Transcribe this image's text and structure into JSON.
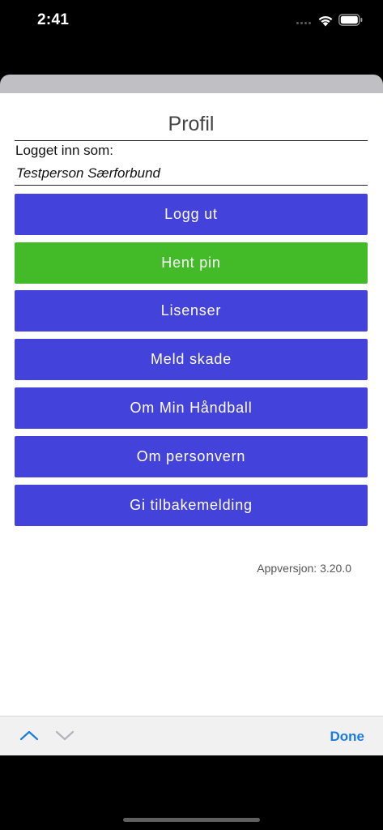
{
  "status_bar": {
    "time": "2:41"
  },
  "profile": {
    "title": "Profil",
    "logged_in_label": "Logget inn som:",
    "user_name": "Testperson Særforbund"
  },
  "buttons": {
    "logout": "Logg ut",
    "get_pin": "Hent pin",
    "licenses": "Lisenser",
    "report_injury": "Meld skade",
    "about_app": "Om Min Håndball",
    "privacy": "Om personvern",
    "feedback": "Gi tilbakemelding"
  },
  "version": "Appversjon: 3.20.0",
  "accessory": {
    "done_label": "Done"
  },
  "colors": {
    "button_blue": "#4343db",
    "button_green": "#43bb28",
    "done_blue": "#1a7ce0"
  }
}
